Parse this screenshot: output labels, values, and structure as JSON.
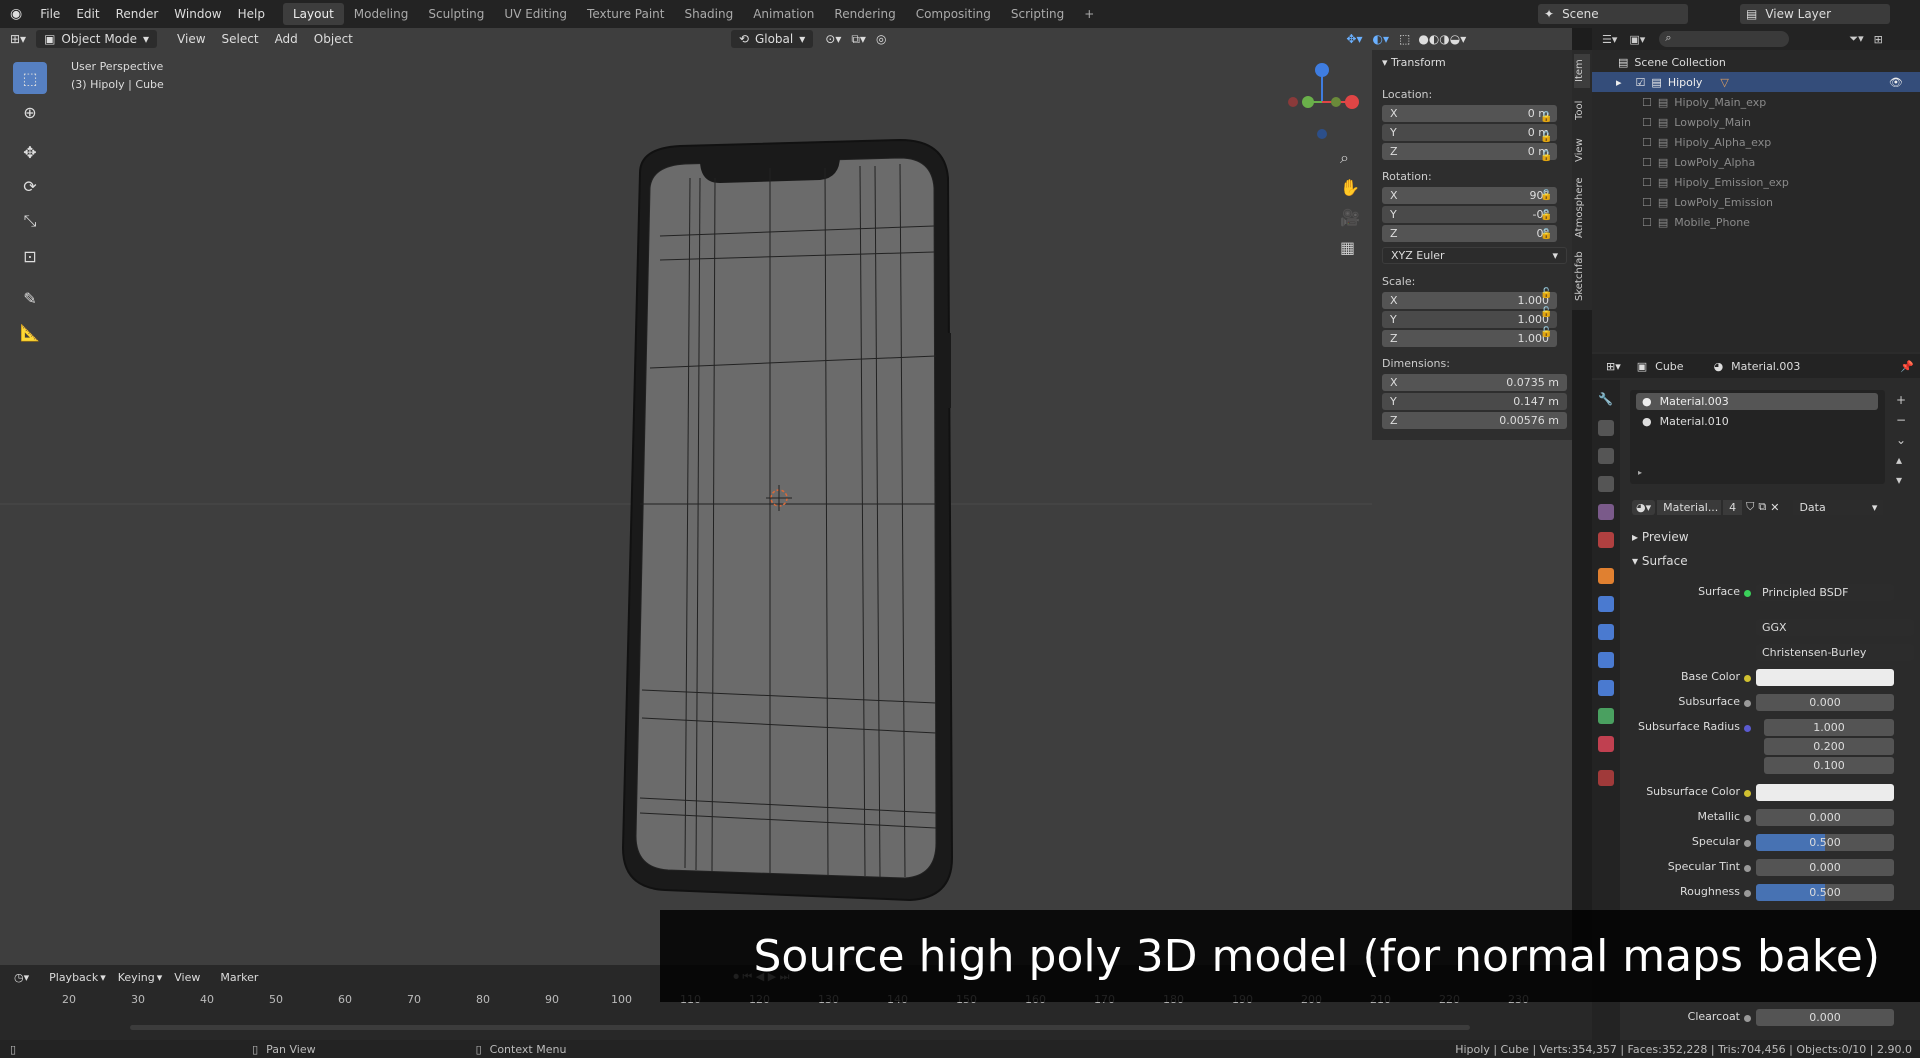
{
  "top": {
    "menu": [
      "File",
      "Edit",
      "Render",
      "Window",
      "Help"
    ],
    "workspaces": [
      "Layout",
      "Modeling",
      "Sculpting",
      "UV Editing",
      "Texture Paint",
      "Shading",
      "Animation",
      "Rendering",
      "Compositing",
      "Scripting"
    ],
    "active_ws": "Layout",
    "scene": "Scene",
    "view_layer": "View Layer"
  },
  "viewport": {
    "mode": "Object Mode",
    "menus": [
      "View",
      "Select",
      "Add",
      "Object"
    ],
    "transform_orient": "Global",
    "title": "User Perspective",
    "subtitle": "(3) Hipoly | Cube"
  },
  "npanel": {
    "header": "Transform",
    "location_label": "Location:",
    "location": [
      {
        "axis": "X",
        "val": "0 m"
      },
      {
        "axis": "Y",
        "val": "0 m"
      },
      {
        "axis": "Z",
        "val": "0 m"
      }
    ],
    "rotation_label": "Rotation:",
    "rotation": [
      {
        "axis": "X",
        "val": "90°"
      },
      {
        "axis": "Y",
        "val": "-0°"
      },
      {
        "axis": "Z",
        "val": "0°"
      }
    ],
    "rot_mode": "XYZ Euler",
    "scale_label": "Scale:",
    "scale": [
      {
        "axis": "X",
        "val": "1.000"
      },
      {
        "axis": "Y",
        "val": "1.000"
      },
      {
        "axis": "Z",
        "val": "1.000"
      }
    ],
    "dim_label": "Dimensions:",
    "dimensions": [
      {
        "axis": "X",
        "val": "0.0735 m"
      },
      {
        "axis": "Y",
        "val": "0.147 m"
      },
      {
        "axis": "Z",
        "val": "0.00576 m"
      }
    ],
    "tabs": [
      "Item",
      "Tool",
      "View",
      "Atmosphere",
      "Sketchfab"
    ]
  },
  "outliner": {
    "root": "Scene Collection",
    "items": [
      "Hipoly",
      "Hipoly_Main_exp",
      "Lowpoly_Main",
      "Hipoly_Alpha_exp",
      "LowPoly_Alpha",
      "Hipoly_Emission_exp",
      "LowPoly_Emission",
      "Mobile_Phone"
    ]
  },
  "props": {
    "object": "Cube",
    "material": "Material.003",
    "slots": [
      "Material.003",
      "Material.010"
    ],
    "mat_short": "Material...",
    "users": "4",
    "link": "Data",
    "preview": "Preview",
    "surface_hdr": "Surface",
    "rows": [
      {
        "label": "Surface",
        "val": "Principled BSDF"
      },
      {
        "label": "",
        "val": "GGX"
      },
      {
        "label": "",
        "val": "Christensen-Burley"
      },
      {
        "label": "Base Color",
        "val": ""
      },
      {
        "label": "Subsurface",
        "val": "0.000"
      },
      {
        "label": "Subsurface Radius",
        "val": "1.000"
      },
      {
        "label": "",
        "val": "0.200"
      },
      {
        "label": "",
        "val": "0.100"
      },
      {
        "label": "Subsurface Color",
        "val": ""
      },
      {
        "label": "Metallic",
        "val": "0.000"
      },
      {
        "label": "Specular",
        "val": "0.500"
      },
      {
        "label": "Specular Tint",
        "val": "0.000"
      },
      {
        "label": "Roughness",
        "val": "0.500"
      },
      {
        "label": "Clearcoat",
        "val": "0.000"
      }
    ]
  },
  "timeline": {
    "menus": [
      "Playback",
      "Keying",
      "View",
      "Marker"
    ],
    "ticks": [
      "20",
      "30",
      "40",
      "50",
      "60",
      "70",
      "80",
      "90",
      "100",
      "110",
      "120",
      "130",
      "140",
      "150",
      "160",
      "170",
      "180",
      "190",
      "200",
      "210",
      "220",
      "230"
    ]
  },
  "status": {
    "pan": "Pan View",
    "context": "Context Menu",
    "stats": "Hipoly | Cube | Verts:354,357 | Faces:352,228 | Tris:704,456 | Objects:0/10 | 2.90.0"
  },
  "caption": "Source high poly 3D model (for normal maps bake)"
}
